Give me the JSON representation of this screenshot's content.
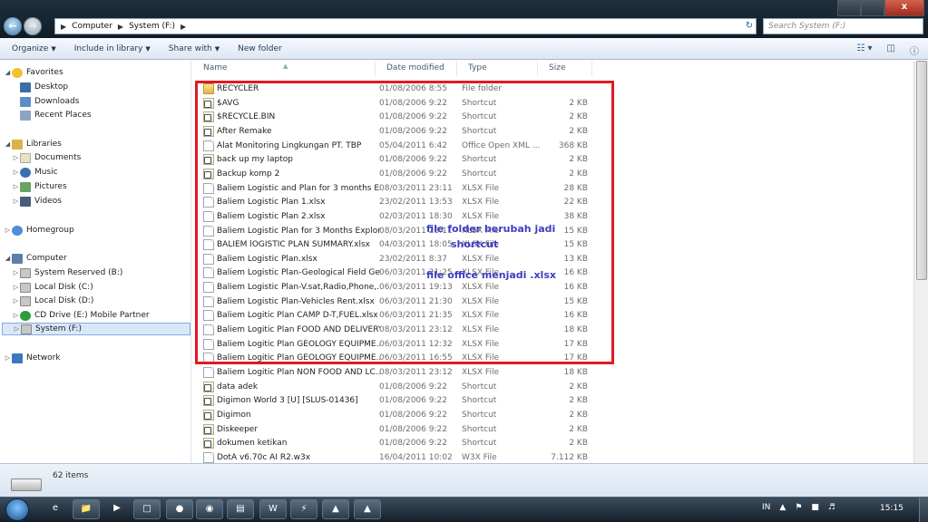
{
  "window": {
    "close_glyph": "x",
    "address_path": [
      "Computer",
      "System (F:)"
    ],
    "search_placeholder": "Search System (F:)"
  },
  "toolbar": {
    "organize": "Organize",
    "include_in_library": "Include in library",
    "share_with": "Share with",
    "new_folder": "New folder"
  },
  "sidebar": {
    "favorites": "Favorites",
    "desktop": "Desktop",
    "downloads": "Downloads",
    "recent_places": "Recent Places",
    "libraries": "Libraries",
    "documents": "Documents",
    "music": "Music",
    "pictures": "Pictures",
    "videos": "Videos",
    "homegroup": "Homegroup",
    "computer": "Computer",
    "drive_b": "System Reserved (B:)",
    "drive_c": "Local Disk (C:)",
    "drive_d": "Local Disk (D:)",
    "drive_e": "CD Drive (E:) Mobile Partner",
    "drive_f": "System (F:)",
    "network": "Network"
  },
  "columns": {
    "name": "Name",
    "date": "Date modified",
    "type": "Type",
    "size": "Size"
  },
  "files": [
    {
      "name": "RECYCLER",
      "date": "01/08/2006 8:55",
      "type": "File folder",
      "size": "",
      "icon": "folder-lock-icon"
    },
    {
      "name": "$AVG",
      "date": "01/08/2006 9:22",
      "type": "Shortcut",
      "size": "2 KB",
      "icon": "shortcut-icon"
    },
    {
      "name": "$RECYCLE.BIN",
      "date": "01/08/2006 9:22",
      "type": "Shortcut",
      "size": "2 KB",
      "icon": "shortcut-icon"
    },
    {
      "name": "After Remake",
      "date": "01/08/2006 9:22",
      "type": "Shortcut",
      "size": "2 KB",
      "icon": "shortcut-icon"
    },
    {
      "name": "Alat Monitoring Lingkungan PT. TBP",
      "date": "05/04/2011 6:42",
      "type": "Office Open XML ...",
      "size": "368 KB",
      "icon": "file-icon"
    },
    {
      "name": "back up my laptop",
      "date": "01/08/2006 9:22",
      "type": "Shortcut",
      "size": "2 KB",
      "icon": "shortcut-icon"
    },
    {
      "name": "Backup komp 2",
      "date": "01/08/2006 9:22",
      "type": "Shortcut",
      "size": "2 KB",
      "icon": "shortcut-icon"
    },
    {
      "name": "Baliem Logistic and Plan for 3 months Ex...",
      "date": "08/03/2011 23:11",
      "type": "XLSX File",
      "size": "28 KB",
      "icon": "file-icon"
    },
    {
      "name": "Baliem Logistic Plan 1.xlsx",
      "date": "23/02/2011 13:53",
      "type": "XLSX File",
      "size": "22 KB",
      "icon": "file-icon"
    },
    {
      "name": "Baliem Logistic Plan 2.xlsx",
      "date": "02/03/2011 18:30",
      "type": "XLSX File",
      "size": "38 KB",
      "icon": "file-icon"
    },
    {
      "name": "Baliem Logistic Plan for 3 Months Explor...",
      "date": "08/03/2011 23:11",
      "type": "XLSX File",
      "size": "15 KB",
      "icon": "file-icon"
    },
    {
      "name": "BALIEM lOGISTIC PLAN SUMMARY.xlsx",
      "date": "04/03/2011 18:05",
      "type": "XLSX File",
      "size": "15 KB",
      "icon": "file-icon"
    },
    {
      "name": "Baliem Logistic Plan.xlsx",
      "date": "23/02/2011 8:37",
      "type": "XLSX File",
      "size": "13 KB",
      "icon": "file-icon"
    },
    {
      "name": "Baliem Logistic Plan-Geological Field Ge...",
      "date": "06/03/2011 21:25",
      "type": "XLSX File",
      "size": "16 KB",
      "icon": "file-icon"
    },
    {
      "name": "Baliem Logistic Plan-V.sat,Radio,Phone,...",
      "date": "06/03/2011 19:13",
      "type": "XLSX File",
      "size": "16 KB",
      "icon": "file-icon"
    },
    {
      "name": "Baliem Logistic Plan-Vehicles Rent.xlsx",
      "date": "06/03/2011 21:30",
      "type": "XLSX File",
      "size": "15 KB",
      "icon": "file-icon"
    },
    {
      "name": "Baliem Logitic Plan CAMP D-T,FUEL.xlsx",
      "date": "06/03/2011 21:35",
      "type": "XLSX File",
      "size": "16 KB",
      "icon": "file-icon"
    },
    {
      "name": "Baliem Logitic Plan FOOD AND DELIVERY....",
      "date": "08/03/2011 23:12",
      "type": "XLSX File",
      "size": "18 KB",
      "icon": "file-icon"
    },
    {
      "name": "Baliem Logitic Plan GEOLOGY EQUIPME...",
      "date": "06/03/2011 12:32",
      "type": "XLSX File",
      "size": "17 KB",
      "icon": "file-icon"
    },
    {
      "name": "Baliem Logitic Plan GEOLOGY EQUIPME...",
      "date": "06/03/2011 16:55",
      "type": "XLSX File",
      "size": "17 KB",
      "icon": "file-icon"
    },
    {
      "name": "Baliem Logitic Plan NON FOOD AND LC...",
      "date": "08/03/2011 23:12",
      "type": "XLSX File",
      "size": "18 KB",
      "icon": "file-icon"
    },
    {
      "name": "data adek",
      "date": "01/08/2006 9:22",
      "type": "Shortcut",
      "size": "2 KB",
      "icon": "shortcut-icon"
    },
    {
      "name": "Digimon World 3 [U] [SLUS-01436]",
      "date": "01/08/2006 9:22",
      "type": "Shortcut",
      "size": "2 KB",
      "icon": "shortcut-icon"
    },
    {
      "name": "Digimon",
      "date": "01/08/2006 9:22",
      "type": "Shortcut",
      "size": "2 KB",
      "icon": "shortcut-icon"
    },
    {
      "name": "Diskeeper",
      "date": "01/08/2006 9:22",
      "type": "Shortcut",
      "size": "2 KB",
      "icon": "shortcut-icon"
    },
    {
      "name": "dokumen ketikan",
      "date": "01/08/2006 9:22",
      "type": "Shortcut",
      "size": "2 KB",
      "icon": "shortcut-icon"
    },
    {
      "name": "DotA v6.70c AI R2.w3x",
      "date": "16/04/2011 10:02",
      "type": "W3X File",
      "size": "7.112 KB",
      "icon": "file-icon"
    }
  ],
  "annotations": {
    "line1": "file folder berubah jadi",
    "line2": "shortcut",
    "line3": "file office menjadi .xlsx"
  },
  "status": {
    "item_count": "62 items"
  },
  "taskbar": {
    "lang": "IN",
    "clock": "15:15"
  },
  "colors": {
    "annotation_box": "#e01a24",
    "annotation_text": "#3d3ec2",
    "selection": "#d9e8f9"
  }
}
